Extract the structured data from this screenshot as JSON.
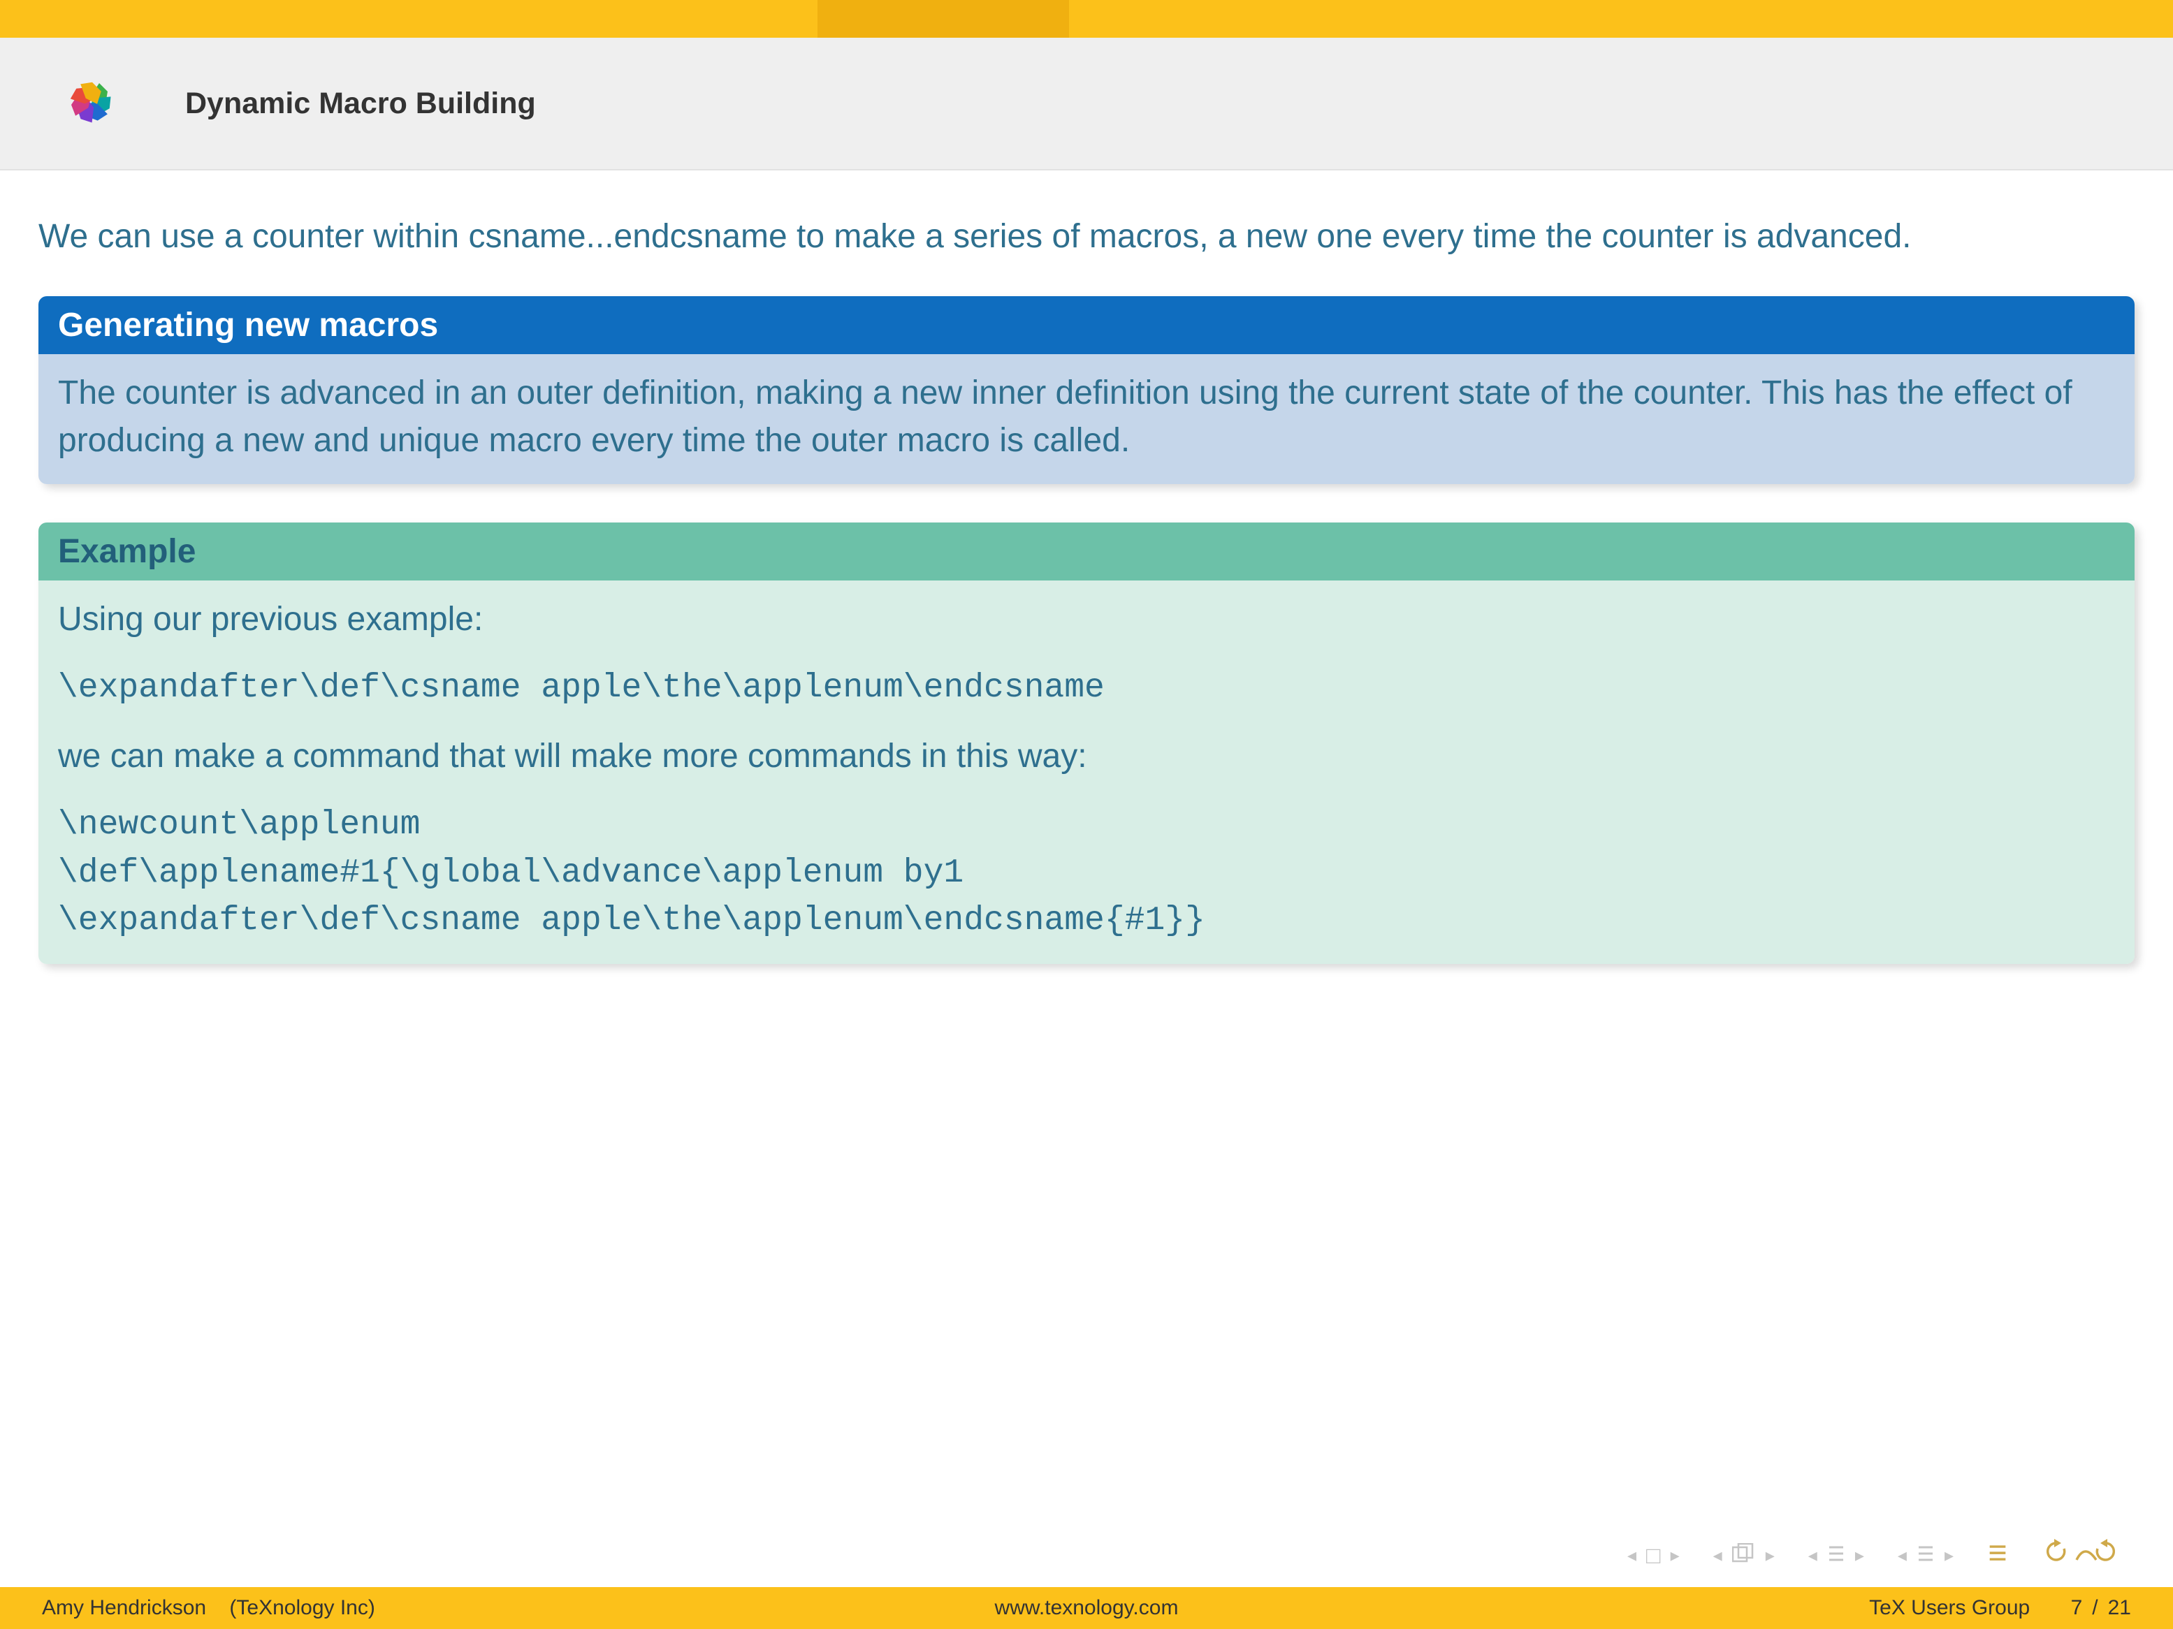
{
  "header": {
    "title": "Dynamic Macro Building"
  },
  "intro": "We can use a counter within csname...endcsname to make a series of macros, a new one every time the counter is advanced.",
  "block1": {
    "title": "Generating new macros",
    "body": "The counter is advanced in an outer definition, making a new inner definition using the current state of the counter. This has the effect of producing a new and unique macro every time the outer macro is called."
  },
  "block2": {
    "title": "Example",
    "line1": "Using our previous example:",
    "code1": "\\expandafter\\def\\csname apple\\the\\applenum\\endcsname",
    "line2": "we can make a command that will make more commands in this way:",
    "code2a": "\\newcount\\applenum",
    "code2b": "\\def\\applename#1{\\global\\advance\\applenum by1",
    "code2c": "\\expandafter\\def\\csname apple\\the\\applenum\\endcsname{#1}}"
  },
  "footer": {
    "author": "Amy Hendrickson",
    "affiliation": "(TeXnology Inc)",
    "center": "www.texnology.com",
    "venue": "TeX Users Group",
    "page_current": "7",
    "page_total": "21"
  }
}
